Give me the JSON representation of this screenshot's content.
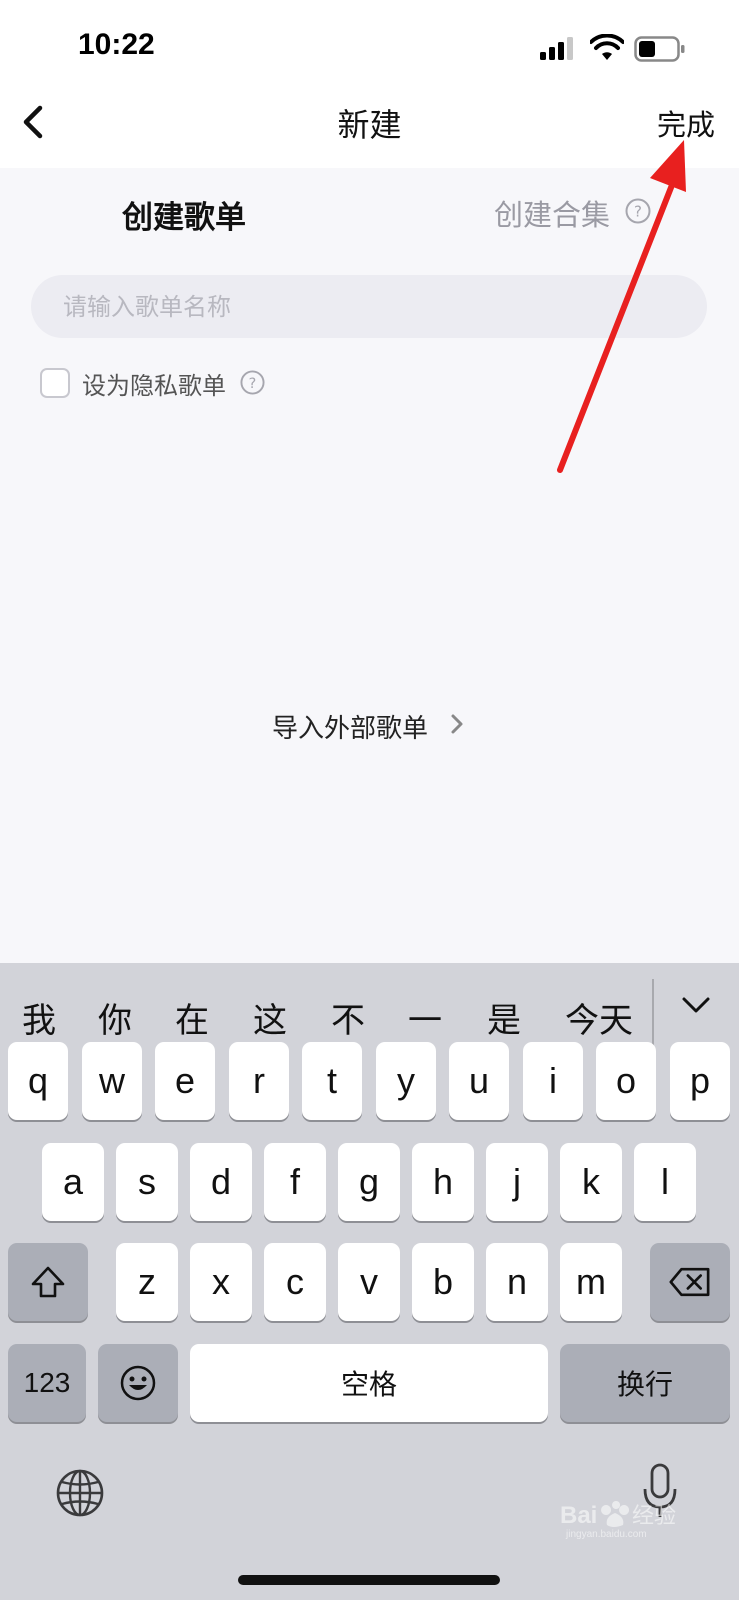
{
  "status_bar": {
    "time": "10:22"
  },
  "nav": {
    "title": "新建",
    "done_label": "完成"
  },
  "tabs": {
    "playlist": "创建歌单",
    "collection": "创建合集"
  },
  "name_input": {
    "placeholder": "请输入歌单名称",
    "value": ""
  },
  "privacy": {
    "label": "设为隐私歌单",
    "checked": false
  },
  "import_link": "导入外部歌单",
  "keyboard": {
    "candidates": [
      "我",
      "你",
      "在",
      "这",
      "不",
      "一",
      "是",
      "今天"
    ],
    "row1": [
      "q",
      "w",
      "e",
      "r",
      "t",
      "y",
      "u",
      "i",
      "o",
      "p"
    ],
    "row2": [
      "a",
      "s",
      "d",
      "f",
      "g",
      "h",
      "j",
      "k",
      "l"
    ],
    "row3": [
      "z",
      "x",
      "c",
      "v",
      "b",
      "n",
      "m"
    ],
    "numbers_label": "123",
    "space_label": "空格",
    "return_label": "换行"
  },
  "watermark": {
    "text": "Bai 经验",
    "url": "jingyan.baidu.com"
  },
  "colors": {
    "annotation_arrow": "#e8201f",
    "keyboard_bg": "#d2d3d9",
    "page_bg": "#f7f7fa"
  }
}
